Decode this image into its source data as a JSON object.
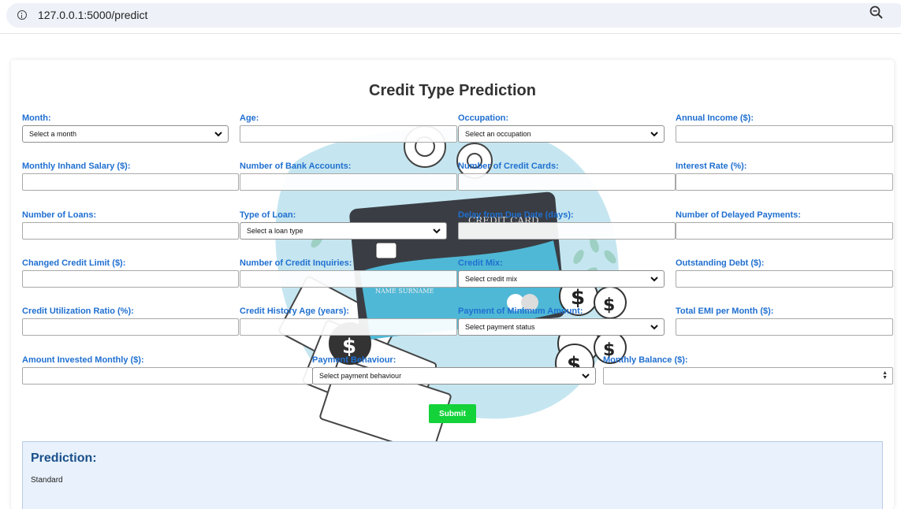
{
  "browser": {
    "url": "127.0.0.1:5000/predict"
  },
  "page": {
    "title": "Credit Type Prediction"
  },
  "fields": {
    "month": {
      "label": "Month:",
      "value": "Select a month"
    },
    "age": {
      "label": "Age:"
    },
    "occupation": {
      "label": "Occupation:",
      "value": "Select an occupation"
    },
    "annual_income": {
      "label": "Annual Income ($):"
    },
    "monthly_inhand_salary": {
      "label": "Monthly Inhand Salary ($):"
    },
    "num_bank_accounts": {
      "label": "Number of Bank Accounts:"
    },
    "num_credit_cards": {
      "label": "Number of Credit Cards:"
    },
    "interest_rate": {
      "label": "Interest Rate (%):"
    },
    "num_loans": {
      "label": "Number of Loans:"
    },
    "type_of_loan": {
      "label": "Type of Loan:",
      "value": "Select a loan type"
    },
    "delay_from_due_date": {
      "label": "Delay from Due Date (days):"
    },
    "num_delayed_payments": {
      "label": "Number of Delayed Payments:"
    },
    "changed_credit_limit": {
      "label": "Changed Credit Limit ($):"
    },
    "num_credit_inquiries": {
      "label": "Number of Credit Inquiries:"
    },
    "credit_mix": {
      "label": "Credit Mix:",
      "value": "Select credit mix"
    },
    "outstanding_debt": {
      "label": "Outstanding Debt ($):"
    },
    "credit_utilization_ratio": {
      "label": "Credit Utilization Ratio (%):"
    },
    "credit_history_age": {
      "label": "Credit History Age (years):"
    },
    "payment_of_min_amount": {
      "label": "Payment of Minimum Amount:",
      "value": "Select payment status"
    },
    "total_emi_per_month": {
      "label": "Total EMI per Month ($):"
    },
    "amount_invested_monthly": {
      "label": "Amount Invested Monthly ($):"
    },
    "payment_behaviour": {
      "label": "Payment Behaviour:",
      "value": "Select payment behaviour"
    },
    "monthly_balance": {
      "label": "Monthly Balance ($):"
    }
  },
  "submit_label": "Submit",
  "background_card_text": {
    "brand": "CREDIT CARD",
    "holder": "NAME SURNAME"
  },
  "prediction": {
    "title": "Prediction:",
    "value": "Standard"
  },
  "colors": {
    "label": "#1f6fd0",
    "submit": "#14d23a",
    "prediction_bg": "#e8f1fc"
  }
}
